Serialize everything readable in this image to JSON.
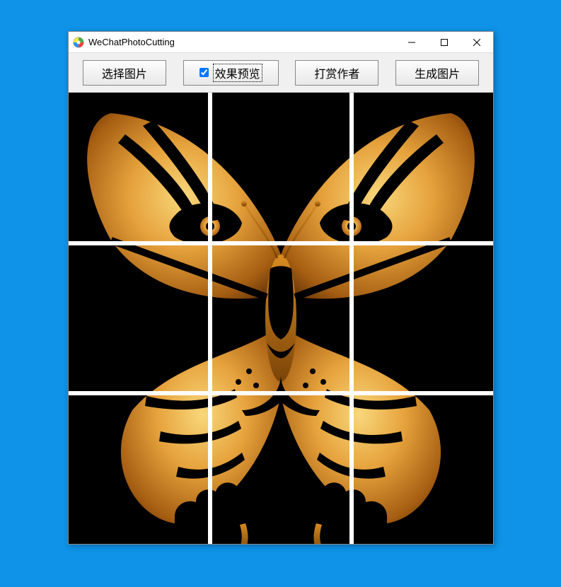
{
  "window": {
    "title": "WeChatPhotoCutting"
  },
  "toolbar": {
    "select_image_label": "选择图片",
    "preview_checkbox_label": "效果预览",
    "preview_checked": true,
    "reward_author_label": "打赏作者",
    "generate_label": "生成图片"
  },
  "preview": {
    "grid_rows": 3,
    "grid_cols": 3,
    "background_color": "#000000",
    "accent_color": "#e6a23c"
  }
}
